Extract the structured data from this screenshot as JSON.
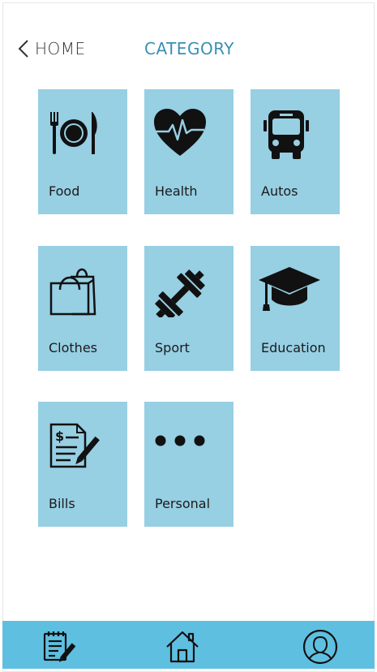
{
  "header": {
    "back_label": "HOME",
    "title": "CATEGORY"
  },
  "categories": [
    {
      "label": "Food",
      "icon": "fork-plate-knife-icon"
    },
    {
      "label": "Health",
      "icon": "heart-pulse-icon"
    },
    {
      "label": "Autos",
      "icon": "bus-icon"
    },
    {
      "label": "Clothes",
      "icon": "shopping-bags-icon"
    },
    {
      "label": "Sport",
      "icon": "dumbbell-icon"
    },
    {
      "label": "Education",
      "icon": "graduation-cap-icon"
    },
    {
      "label": "Bills",
      "icon": "invoice-pen-icon"
    },
    {
      "label": "Personal",
      "icon": "more-dots-icon"
    }
  ],
  "bottom_nav": [
    {
      "icon": "notepad-pencil-icon"
    },
    {
      "icon": "home-icon"
    },
    {
      "icon": "user-profile-icon"
    }
  ],
  "colors": {
    "tile": "#97cfe3",
    "accent": "#3a8fb5",
    "bottom_bar": "#5fbfe0"
  }
}
